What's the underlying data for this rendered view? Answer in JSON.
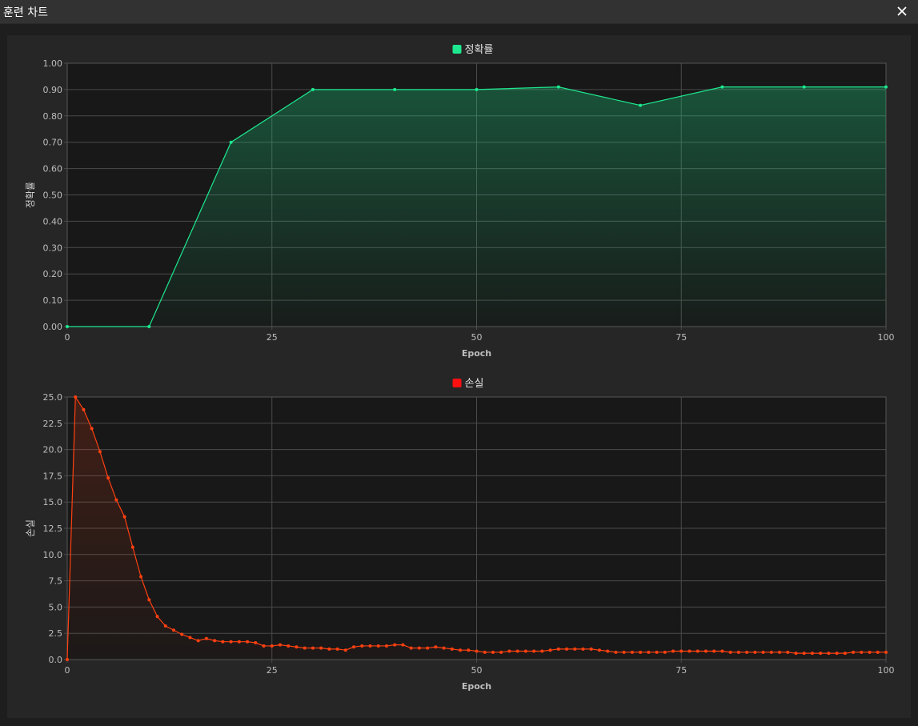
{
  "window": {
    "title": "훈련 차트",
    "close_icon": "close-icon"
  },
  "colors": {
    "accuracy": "#1de88f",
    "loss": "#ff4010",
    "loss_legend": "#ff1010",
    "grid": "#4a4a4a",
    "plot_bg": "#181818"
  },
  "chart_data": [
    {
      "type": "area",
      "legend": "정확률",
      "xlabel": "Epoch",
      "ylabel": "정확률",
      "xlim": [
        0,
        100
      ],
      "ylim": [
        0,
        1
      ],
      "xticks": [
        "0",
        "25",
        "50",
        "75",
        "100"
      ],
      "yticks": [
        "0.00",
        "0.10",
        "0.20",
        "0.30",
        "0.40",
        "0.50",
        "0.60",
        "0.70",
        "0.80",
        "0.90",
        "1.00"
      ],
      "grid": true,
      "legend_position": "top-center",
      "series": [
        {
          "name": "정확률",
          "x": [
            0,
            10,
            20,
            30,
            40,
            50,
            60,
            70,
            80,
            90,
            100
          ],
          "y": [
            0.0,
            0.0,
            0.7,
            0.9,
            0.9,
            0.9,
            0.91,
            0.84,
            0.91,
            0.91,
            0.91
          ]
        }
      ]
    },
    {
      "type": "area",
      "legend": "손실",
      "xlabel": "Epoch",
      "ylabel": "손실",
      "xlim": [
        0,
        100
      ],
      "ylim": [
        0,
        25
      ],
      "xticks": [
        "0",
        "25",
        "50",
        "75",
        "100"
      ],
      "yticks": [
        "0.0",
        "2.5",
        "5.0",
        "7.5",
        "10.0",
        "12.5",
        "15.0",
        "17.5",
        "20.0",
        "22.5",
        "25.0"
      ],
      "grid": true,
      "legend_position": "top-center",
      "series": [
        {
          "name": "손실",
          "x": [
            0,
            1,
            2,
            3,
            4,
            5,
            6,
            7,
            8,
            9,
            10,
            11,
            12,
            13,
            14,
            15,
            16,
            17,
            18,
            19,
            20,
            21,
            22,
            23,
            24,
            25,
            26,
            27,
            28,
            29,
            30,
            31,
            32,
            33,
            34,
            35,
            36,
            37,
            38,
            39,
            40,
            41,
            42,
            43,
            44,
            45,
            46,
            47,
            48,
            49,
            50,
            51,
            52,
            53,
            54,
            55,
            56,
            57,
            58,
            59,
            60,
            61,
            62,
            63,
            64,
            65,
            66,
            67,
            68,
            69,
            70,
            71,
            72,
            73,
            74,
            75,
            76,
            77,
            78,
            79,
            80,
            81,
            82,
            83,
            84,
            85,
            86,
            87,
            88,
            89,
            90,
            91,
            92,
            93,
            94,
            95,
            96,
            97,
            98,
            99,
            100
          ],
          "y": [
            0.0,
            25.0,
            23.8,
            22.0,
            19.8,
            17.3,
            15.2,
            13.6,
            10.7,
            7.9,
            5.7,
            4.1,
            3.2,
            2.8,
            2.4,
            2.1,
            1.8,
            2.0,
            1.8,
            1.7,
            1.7,
            1.7,
            1.7,
            1.6,
            1.3,
            1.3,
            1.4,
            1.3,
            1.2,
            1.1,
            1.1,
            1.1,
            1.0,
            1.0,
            0.9,
            1.2,
            1.3,
            1.3,
            1.3,
            1.3,
            1.4,
            1.4,
            1.1,
            1.1,
            1.1,
            1.2,
            1.1,
            1.0,
            0.9,
            0.9,
            0.8,
            0.7,
            0.7,
            0.7,
            0.8,
            0.8,
            0.8,
            0.8,
            0.8,
            0.9,
            1.0,
            1.0,
            1.0,
            1.0,
            1.0,
            0.9,
            0.8,
            0.7,
            0.7,
            0.7,
            0.7,
            0.7,
            0.7,
            0.7,
            0.8,
            0.8,
            0.8,
            0.8,
            0.8,
            0.8,
            0.8,
            0.7,
            0.7,
            0.7,
            0.7,
            0.7,
            0.7,
            0.7,
            0.7,
            0.6,
            0.6,
            0.6,
            0.6,
            0.6,
            0.6,
            0.6,
            0.7,
            0.7,
            0.7,
            0.7,
            0.7
          ]
        }
      ]
    }
  ]
}
